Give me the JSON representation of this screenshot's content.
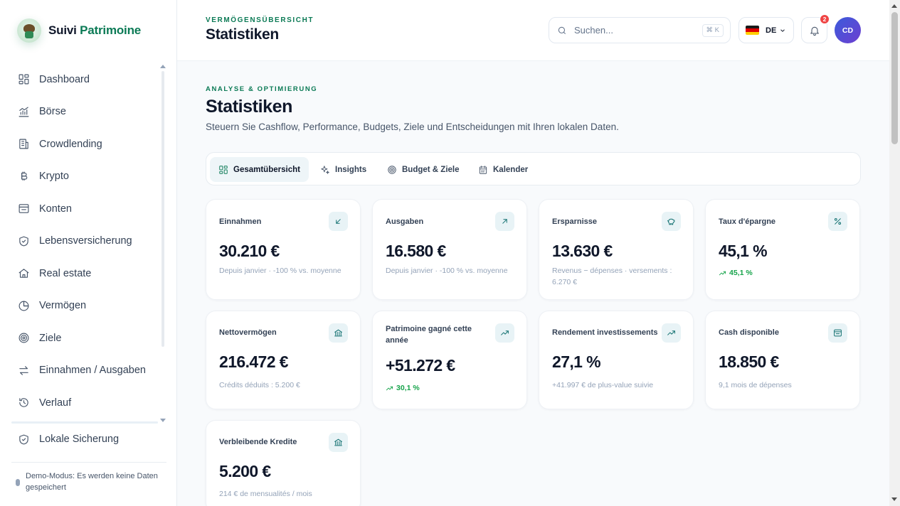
{
  "brand": {
    "name_part1": "Suivi",
    "name_part2": "Patrimoine",
    "logo": "cowboy-avatar-logo"
  },
  "sidebar": {
    "items": [
      {
        "label": "Dashboard",
        "icon": "grid-icon"
      },
      {
        "label": "Börse",
        "icon": "chart-bars-icon"
      },
      {
        "label": "Crowdlending",
        "icon": "building-icon"
      },
      {
        "label": "Krypto",
        "icon": "bitcoin-icon"
      },
      {
        "label": "Konten",
        "icon": "wallet-icon"
      },
      {
        "label": "Lebensversicherung",
        "icon": "shield-icon"
      },
      {
        "label": "Real estate",
        "icon": "home-icon"
      },
      {
        "label": "Vermögen",
        "icon": "pie-chart-icon"
      },
      {
        "label": "Ziele",
        "icon": "target-icon"
      },
      {
        "label": "Einnahmen / Ausgaben",
        "icon": "swap-icon"
      },
      {
        "label": "Verlauf",
        "icon": "history-icon"
      }
    ],
    "backup_label": "Lokale Sicherung",
    "demo_text": "Demo-Modus: Es werden keine Daten gespeichert"
  },
  "header": {
    "eyebrow": "VERMÖGENSÜBERSICHT",
    "title": "Statistiken",
    "search_placeholder": "Suchen...",
    "shortcut": "⌘ K",
    "language": "DE",
    "notification_count": "2",
    "avatar_initials": "CD"
  },
  "page": {
    "eyebrow": "ANALYSE & OPTIMIERUNG",
    "title": "Statistiken",
    "subtitle": "Steuern Sie Cashflow, Performance, Budgets, Ziele und Entscheidungen mit Ihren lokalen Daten."
  },
  "tabs": [
    {
      "label": "Gesamtübersicht",
      "icon": "grid-icon",
      "active": true
    },
    {
      "label": "Insights",
      "icon": "sparkles-icon",
      "active": false
    },
    {
      "label": "Budget & Ziele",
      "icon": "target-icon",
      "active": false
    },
    {
      "label": "Kalender",
      "icon": "calendar-icon",
      "active": false
    }
  ],
  "cards": [
    {
      "label": "Einnahmen",
      "value": "30.210 €",
      "sub": "Depuis janvier · -100 % vs. moyenne",
      "icon": "arrow-down-left-icon"
    },
    {
      "label": "Ausgaben",
      "value": "16.580 €",
      "sub": "Depuis janvier · -100 % vs. moyenne",
      "icon": "arrow-up-right-icon"
    },
    {
      "label": "Ersparnisse",
      "value": "13.630 €",
      "sub": "Revenus − dépenses · versements : 6.270 €",
      "icon": "piggy-bank-icon"
    },
    {
      "label": "Taux d'épargne",
      "value": "45,1 %",
      "trend": "45,1 %",
      "icon": "percent-icon"
    },
    {
      "label": "Nettovermögen",
      "value": "216.472 €",
      "sub": "Crédits déduits : 5.200 €",
      "icon": "bank-icon"
    },
    {
      "label": "Patrimoine gagné cette année",
      "value": "+51.272 €",
      "trend": "30,1 %",
      "icon": "trending-up-icon"
    },
    {
      "label": "Rendement investissements",
      "value": "27,1 %",
      "sub": "+41.997 € de plus-value suivie",
      "icon": "trending-up-icon"
    },
    {
      "label": "Cash disponible",
      "value": "18.850 €",
      "sub": "9,1 mois de dépenses",
      "icon": "wallet-icon"
    },
    {
      "label": "Verbleibende Kredite",
      "value": "5.200 €",
      "sub": "214 € de mensualités / mois",
      "icon": "bank-icon"
    }
  ],
  "colors": {
    "accent": "#0b7a55",
    "trend_positive": "#16a34a",
    "badge": "#ef4444",
    "icon_bg": "#e8f3f6"
  }
}
